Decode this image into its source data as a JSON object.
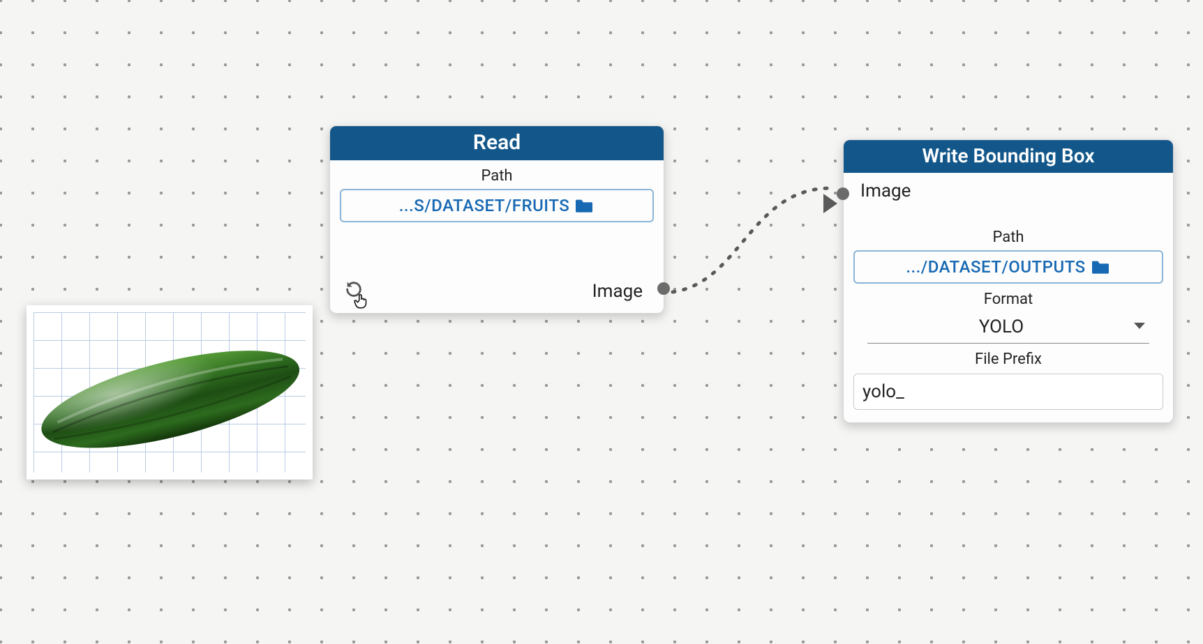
{
  "canvas": {
    "preview_alt": "cucumber on grid"
  },
  "nodes": {
    "read": {
      "title": "Read",
      "path_label": "Path",
      "path_value": "...S/DATASET/FRUITS",
      "output_port": "Image"
    },
    "write": {
      "title": "Write Bounding Box",
      "input_port": "Image",
      "path_label": "Path",
      "path_value": ".../DATASET/OUTPUTS",
      "format_label": "Format",
      "format_value": "YOLO",
      "prefix_label": "File Prefix",
      "prefix_value": "yolo_"
    }
  },
  "colors": {
    "header_bg": "#13578a",
    "link_blue": "#1769b3"
  }
}
